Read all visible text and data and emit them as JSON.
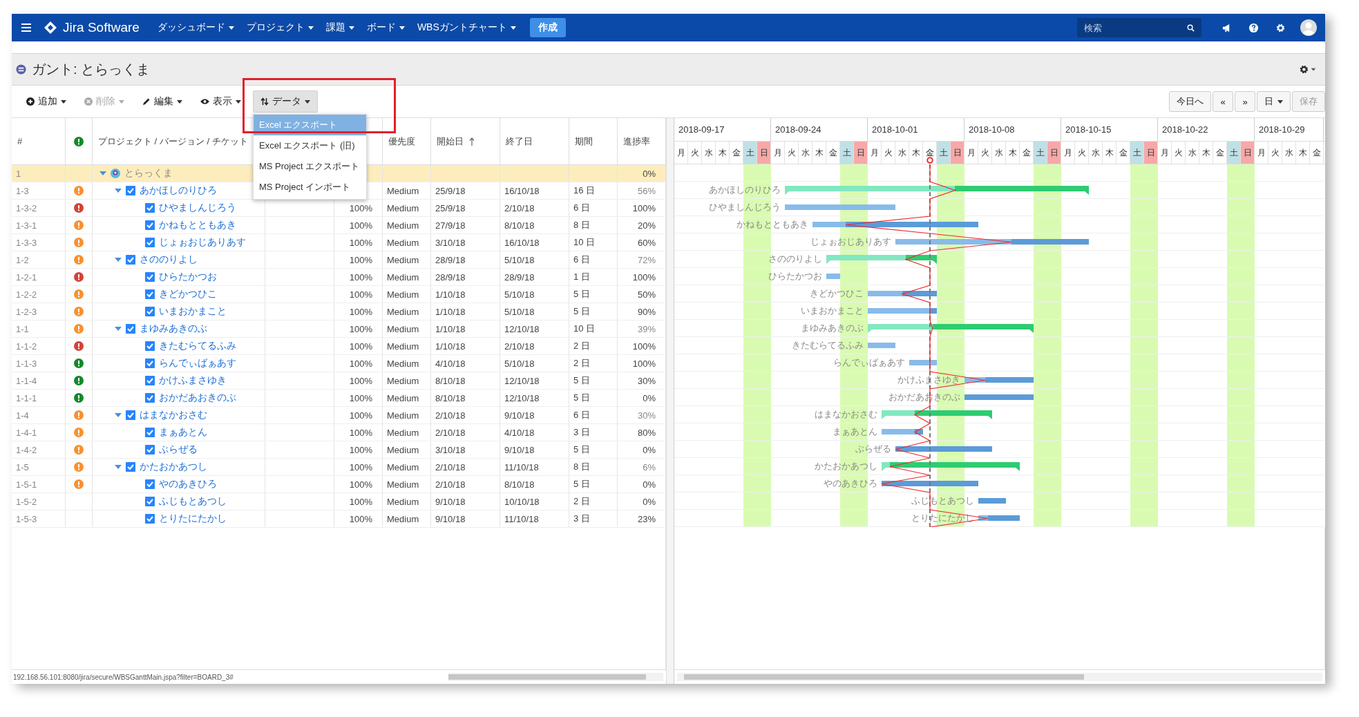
{
  "topbar": {
    "product": "Jira Software",
    "nav": [
      {
        "label": "ダッシュボード"
      },
      {
        "label": "プロジェクト"
      },
      {
        "label": "課題"
      },
      {
        "label": "ボード"
      },
      {
        "label": "WBSガントチャート"
      }
    ],
    "create": "作成",
    "search": {
      "placeholder": "検索"
    }
  },
  "title": "ガント: とらっくま",
  "toolbar": {
    "left": [
      {
        "kind": "add",
        "label": "追加",
        "disabled": false,
        "open": false
      },
      {
        "kind": "delete",
        "label": "削除",
        "disabled": true,
        "open": false
      },
      {
        "kind": "edit",
        "label": "編集",
        "disabled": false,
        "open": false
      },
      {
        "kind": "view",
        "label": "表示",
        "disabled": false,
        "open": false
      },
      {
        "kind": "data",
        "label": "データ",
        "disabled": false,
        "open": true
      }
    ],
    "right": [
      {
        "kind": "text",
        "label": "今日へ",
        "disabled": false
      },
      {
        "kind": "text",
        "label": "«",
        "disabled": false
      },
      {
        "kind": "text",
        "label": "»",
        "disabled": false
      },
      {
        "kind": "dropdown",
        "label": "日",
        "disabled": false
      },
      {
        "kind": "text",
        "label": "保存",
        "disabled": true
      }
    ],
    "menu": [
      {
        "label": "Excel エクスポート",
        "selected": true
      },
      {
        "label": "Excel エクスポート (旧)",
        "selected": false
      },
      {
        "label": "MS Project エクスポート",
        "selected": false
      },
      {
        "label": "MS Project インポート",
        "selected": false
      }
    ]
  },
  "columns": {
    "id": "#",
    "name": "プロジェクト / バージョン / チケット",
    "priority": "優先度",
    "start": "開始日",
    "end": "終了日",
    "duration": "期間",
    "progress": "進捗率"
  },
  "tree": {
    "id": "1",
    "name": "とらっくま",
    "progress": "0%",
    "selected": true,
    "expanded": true,
    "children": [
      {
        "id": "1-3",
        "color": "#f79232",
        "checked": true,
        "expanded": true,
        "selected": false,
        "name": "あかほしのりひろ",
        "priority": "Medium",
        "start": "25/9/18",
        "end": "16/10/18",
        "duration": "16 日",
        "progress": "56%",
        "level": 0.56,
        "bar_label": "あかほしのりひろ",
        "children": [
          {
            "id": "1-3-2",
            "color": "#d04437",
            "checked": true,
            "selected": false,
            "name": "ひやましんじろう",
            "done": "100%",
            "priority": "Medium",
            "start": "25/9/18",
            "end": "2/10/18",
            "duration": "6 日",
            "progress": "100%",
            "level": 1,
            "bar_label": "ひやましんじろう"
          },
          {
            "id": "1-3-1",
            "color": "#f79232",
            "checked": true,
            "selected": false,
            "name": "かねもとともあき",
            "done": "100%",
            "priority": "Medium",
            "start": "27/9/18",
            "end": "8/10/18",
            "duration": "8 日",
            "progress": "20%",
            "level": 0.2,
            "bar_label": "かねもとともあき"
          },
          {
            "id": "1-3-3",
            "color": "#f79232",
            "checked": true,
            "selected": false,
            "name": "じょぉおじありあす",
            "done": "100%",
            "priority": "Medium",
            "start": "3/10/18",
            "end": "16/10/18",
            "duration": "10 日",
            "progress": "60%",
            "level": 0.6,
            "bar_label": "じょぉおじありあす"
          }
        ]
      },
      {
        "id": "1-2",
        "color": "#f79232",
        "checked": true,
        "expanded": true,
        "selected": false,
        "name": "さののりよし",
        "done": "100%",
        "priority": "Medium",
        "start": "28/9/18",
        "end": "5/10/18",
        "duration": "6 日",
        "progress": "72%",
        "level": 0.72,
        "bar_label": "さののりよし",
        "children": [
          {
            "id": "1-2-1",
            "color": "#d04437",
            "checked": true,
            "selected": false,
            "name": "ひらたかつお",
            "done": "100%",
            "priority": "Medium",
            "start": "28/9/18",
            "end": "28/9/18",
            "duration": "1 日",
            "progress": "100%",
            "level": 1,
            "bar_label": "ひらたかつお"
          },
          {
            "id": "1-2-2",
            "color": "#f79232",
            "checked": true,
            "selected": false,
            "name": "きどかつひこ",
            "done": "100%",
            "priority": "Medium",
            "start": "1/10/18",
            "end": "5/10/18",
            "duration": "5 日",
            "progress": "50%",
            "level": 0.5,
            "bar_label": "きどかつひこ"
          },
          {
            "id": "1-2-3",
            "color": "#f79232",
            "checked": true,
            "selected": false,
            "name": "いまおかまこと",
            "done": "100%",
            "priority": "Medium",
            "start": "1/10/18",
            "end": "5/10/18",
            "duration": "5 日",
            "progress": "90%",
            "level": 0.9,
            "bar_label": "いまおかまこと"
          }
        ]
      },
      {
        "id": "1-1",
        "color": "#f79232",
        "checked": true,
        "expanded": true,
        "selected": false,
        "name": "まゆみあきのぶ",
        "done": "100%",
        "priority": "Medium",
        "start": "1/10/18",
        "end": "12/10/18",
        "duration": "10 日",
        "progress": "39%",
        "level": 0.39,
        "bar_label": "まゆみあきのぶ",
        "children": [
          {
            "id": "1-1-2",
            "color": "#d04437",
            "checked": true,
            "selected": false,
            "name": "きたむらてるふみ",
            "done": "100%",
            "priority": "Medium",
            "start": "1/10/18",
            "end": "2/10/18",
            "duration": "2 日",
            "progress": "100%",
            "level": 1,
            "bar_label": "きたむらてるふみ"
          },
          {
            "id": "1-1-3",
            "color": "#14892c",
            "checked": true,
            "selected": false,
            "name": "らんでぃばぁあす",
            "done": "100%",
            "priority": "Medium",
            "start": "4/10/18",
            "end": "5/10/18",
            "duration": "2 日",
            "progress": "100%",
            "level": 1,
            "bar_label": "らんでぃばぁあす"
          },
          {
            "id": "1-1-4",
            "color": "#14892c",
            "checked": true,
            "selected": false,
            "name": "かけふまさゆき",
            "done": "100%",
            "priority": "Medium",
            "start": "8/10/18",
            "end": "12/10/18",
            "duration": "5 日",
            "progress": "30%",
            "level": 0.3,
            "bar_label": "かけふまさゆき"
          },
          {
            "id": "1-1-1",
            "color": "#14892c",
            "checked": true,
            "selected": false,
            "name": "おかだあおきのぶ",
            "done": "100%",
            "priority": "Medium",
            "start": "8/10/18",
            "end": "12/10/18",
            "duration": "5 日",
            "progress": "0%",
            "level": 0,
            "bar_label": "おかだあおきのぶ"
          }
        ]
      },
      {
        "id": "1-4",
        "color": "#f79232",
        "checked": true,
        "expanded": true,
        "selected": false,
        "name": "はまなかおさむ",
        "done": "100%",
        "priority": "Medium",
        "start": "2/10/18",
        "end": "9/10/18",
        "duration": "6 日",
        "progress": "30%",
        "level": 0.3,
        "bar_label": "はまなかおさむ",
        "children": [
          {
            "id": "1-4-1",
            "color": "#f79232",
            "checked": true,
            "selected": false,
            "name": "まぁあとん",
            "done": "100%",
            "priority": "Medium",
            "start": "2/10/18",
            "end": "4/10/18",
            "duration": "3 日",
            "progress": "80%",
            "level": 0.8,
            "bar_label": "まぁあとん"
          },
          {
            "id": "1-4-2",
            "color": "#f79232",
            "checked": true,
            "selected": false,
            "name": "ぶらぜる",
            "done": "100%",
            "priority": "Medium",
            "start": "3/10/18",
            "end": "9/10/18",
            "duration": "5 日",
            "progress": "0%",
            "level": 0,
            "bar_label": "ぶらぜる"
          }
        ]
      },
      {
        "id": "1-5",
        "color": "#f79232",
        "checked": true,
        "expanded": true,
        "selected": false,
        "name": "かたおかあつし",
        "done": "100%",
        "priority": "Medium",
        "start": "2/10/18",
        "end": "11/10/18",
        "duration": "8 日",
        "progress": "6%",
        "level": 0.06,
        "bar_label": "かたおかあつし",
        "children": [
          {
            "id": "1-5-1",
            "color": "#f79232",
            "checked": true,
            "selected": false,
            "name": "やのあきひろ",
            "done": "100%",
            "priority": "Medium",
            "start": "2/10/18",
            "end": "8/10/18",
            "duration": "5 日",
            "progress": "0%",
            "level": 0,
            "bar_label": "やのあきひろ"
          },
          {
            "id": "1-5-2",
            "checked": true,
            "selected": false,
            "name": "ふじもとあつし",
            "done": "100%",
            "priority": "Medium",
            "start": "9/10/18",
            "end": "10/10/18",
            "duration": "2 日",
            "progress": "0%",
            "level": 0,
            "bar_label": "ふじもとあつし"
          },
          {
            "id": "1-5-3",
            "checked": true,
            "selected": false,
            "name": "とりたにたかし",
            "done": "100%",
            "priority": "Medium",
            "start": "9/10/18",
            "end": "11/10/18",
            "duration": "3 日",
            "progress": "23%",
            "level": 0.23,
            "bar_label": "とりたにたかし"
          }
        ]
      }
    ]
  },
  "weeks": [
    {
      "label": "2018-09-17",
      "days": [
        {
          "label": "月",
          "kind": "weekday",
          "today": false
        },
        {
          "label": "火",
          "kind": "weekday",
          "today": false
        },
        {
          "label": "水",
          "kind": "weekday",
          "today": false
        },
        {
          "label": "木",
          "kind": "weekday",
          "today": false
        },
        {
          "label": "金",
          "kind": "weekday",
          "today": false
        },
        {
          "label": "土",
          "kind": "saturday",
          "today": false
        },
        {
          "label": "日",
          "kind": "sunday",
          "today": false
        }
      ]
    },
    {
      "label": "2018-09-24",
      "days": [
        {
          "label": "月",
          "kind": "weekday",
          "today": false
        },
        {
          "label": "火",
          "kind": "weekday",
          "today": false
        },
        {
          "label": "水",
          "kind": "weekday",
          "today": false
        },
        {
          "label": "木",
          "kind": "weekday",
          "today": false
        },
        {
          "label": "金",
          "kind": "weekday",
          "today": false
        },
        {
          "label": "土",
          "kind": "saturday",
          "today": false
        },
        {
          "label": "日",
          "kind": "sunday",
          "today": false
        }
      ]
    },
    {
      "label": "2018-10-01",
      "days": [
        {
          "label": "月",
          "kind": "weekday",
          "today": false
        },
        {
          "label": "火",
          "kind": "weekday",
          "today": false
        },
        {
          "label": "水",
          "kind": "weekday",
          "today": false
        },
        {
          "label": "木",
          "kind": "weekday",
          "today": false
        },
        {
          "label": "金",
          "kind": "weekday",
          "today": true
        },
        {
          "label": "土",
          "kind": "saturday",
          "today": false
        },
        {
          "label": "日",
          "kind": "sunday",
          "today": false
        }
      ]
    },
    {
      "label": "2018-10-08",
      "days": [
        {
          "label": "月",
          "kind": "weekday",
          "today": false
        },
        {
          "label": "火",
          "kind": "weekday",
          "today": false
        },
        {
          "label": "水",
          "kind": "weekday",
          "today": false
        },
        {
          "label": "木",
          "kind": "weekday",
          "today": false
        },
        {
          "label": "金",
          "kind": "weekday",
          "today": false
        },
        {
          "label": "土",
          "kind": "saturday",
          "today": false
        },
        {
          "label": "日",
          "kind": "sunday",
          "today": false
        }
      ]
    },
    {
      "label": "2018-10-15",
      "days": [
        {
          "label": "月",
          "kind": "weekday",
          "today": false
        },
        {
          "label": "火",
          "kind": "weekday",
          "today": false
        },
        {
          "label": "水",
          "kind": "weekday",
          "today": false
        },
        {
          "label": "木",
          "kind": "weekday",
          "today": false
        },
        {
          "label": "金",
          "kind": "weekday",
          "today": false
        },
        {
          "label": "土",
          "kind": "saturday",
          "today": false
        },
        {
          "label": "日",
          "kind": "sunday",
          "today": false
        }
      ]
    },
    {
      "label": "2018-10-22",
      "days": [
        {
          "label": "月",
          "kind": "weekday",
          "today": false
        },
        {
          "label": "火",
          "kind": "weekday",
          "today": false
        },
        {
          "label": "水",
          "kind": "weekday",
          "today": false
        },
        {
          "label": "木",
          "kind": "weekday",
          "today": false
        },
        {
          "label": "金",
          "kind": "weekday",
          "today": false
        },
        {
          "label": "土",
          "kind": "saturday",
          "today": false
        },
        {
          "label": "日",
          "kind": "sunday",
          "today": false
        }
      ]
    },
    {
      "label": "2018-10-29",
      "days": [
        {
          "label": "月",
          "kind": "weekday",
          "today": false
        },
        {
          "label": "火",
          "kind": "weekday",
          "today": false
        },
        {
          "label": "水",
          "kind": "weekday",
          "today": false
        },
        {
          "label": "木",
          "kind": "weekday",
          "today": false
        },
        {
          "label": "金",
          "kind": "weekday",
          "today": false
        }
      ]
    }
  ],
  "status_url": "192.168.56.101:8080/jira/secure/WBSGanttMain.jspa?filter=BOARD_3#"
}
